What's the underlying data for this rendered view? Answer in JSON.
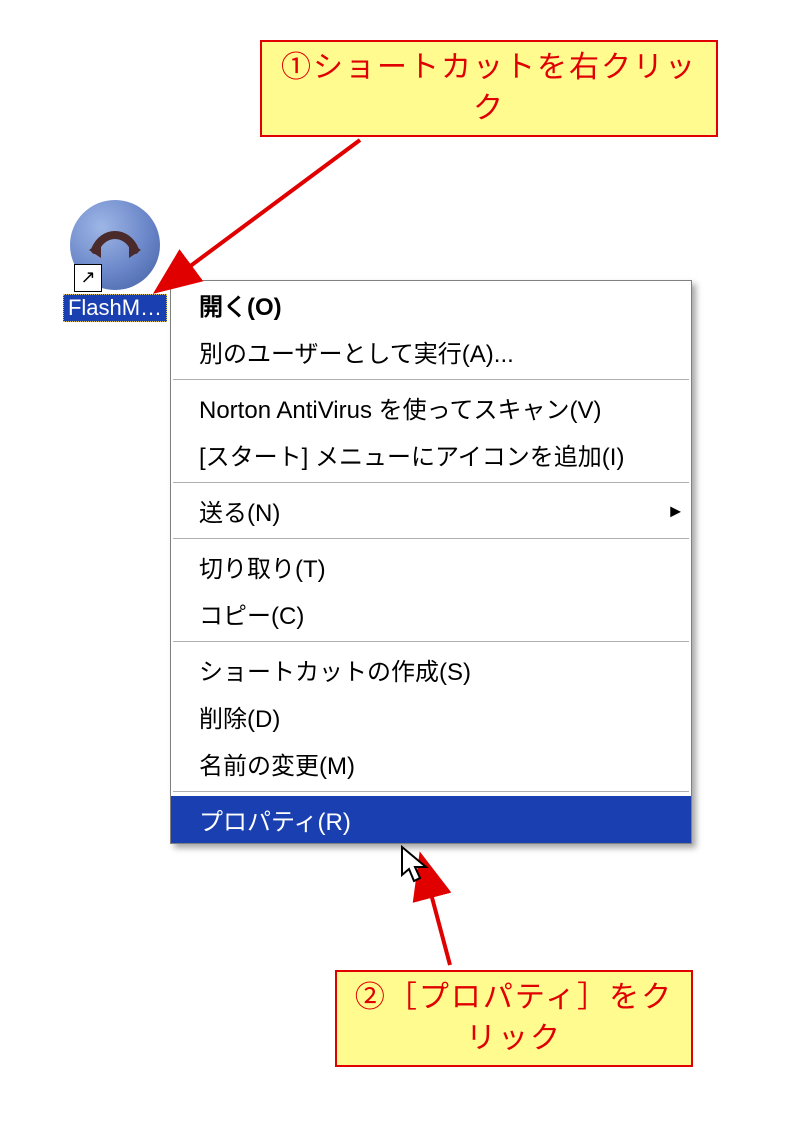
{
  "shortcut": {
    "label": "FlashM…",
    "icon_name": "flash-f-icon"
  },
  "menu": {
    "open": "開く(O)",
    "runas": "別のユーザーとして実行(A)...",
    "norton": "Norton AntiVirus を使ってスキャン(V)",
    "start_pin": "[スタート] メニューにアイコンを追加(I)",
    "send": "送る(N)",
    "cut": "切り取り(T)",
    "copy": "コピー(C)",
    "make_sc": "ショートカットの作成(S)",
    "delete": "削除(D)",
    "rename": "名前の変更(M)",
    "properties": "プロパティ(R)"
  },
  "callouts": {
    "step1": "①ショートカットを右クリック",
    "step2": "②［プロパティ］をクリック"
  },
  "colors": {
    "highlight": "#1a3fb0",
    "callout_bg": "#fffb8f",
    "callout_fg": "#e00000"
  }
}
